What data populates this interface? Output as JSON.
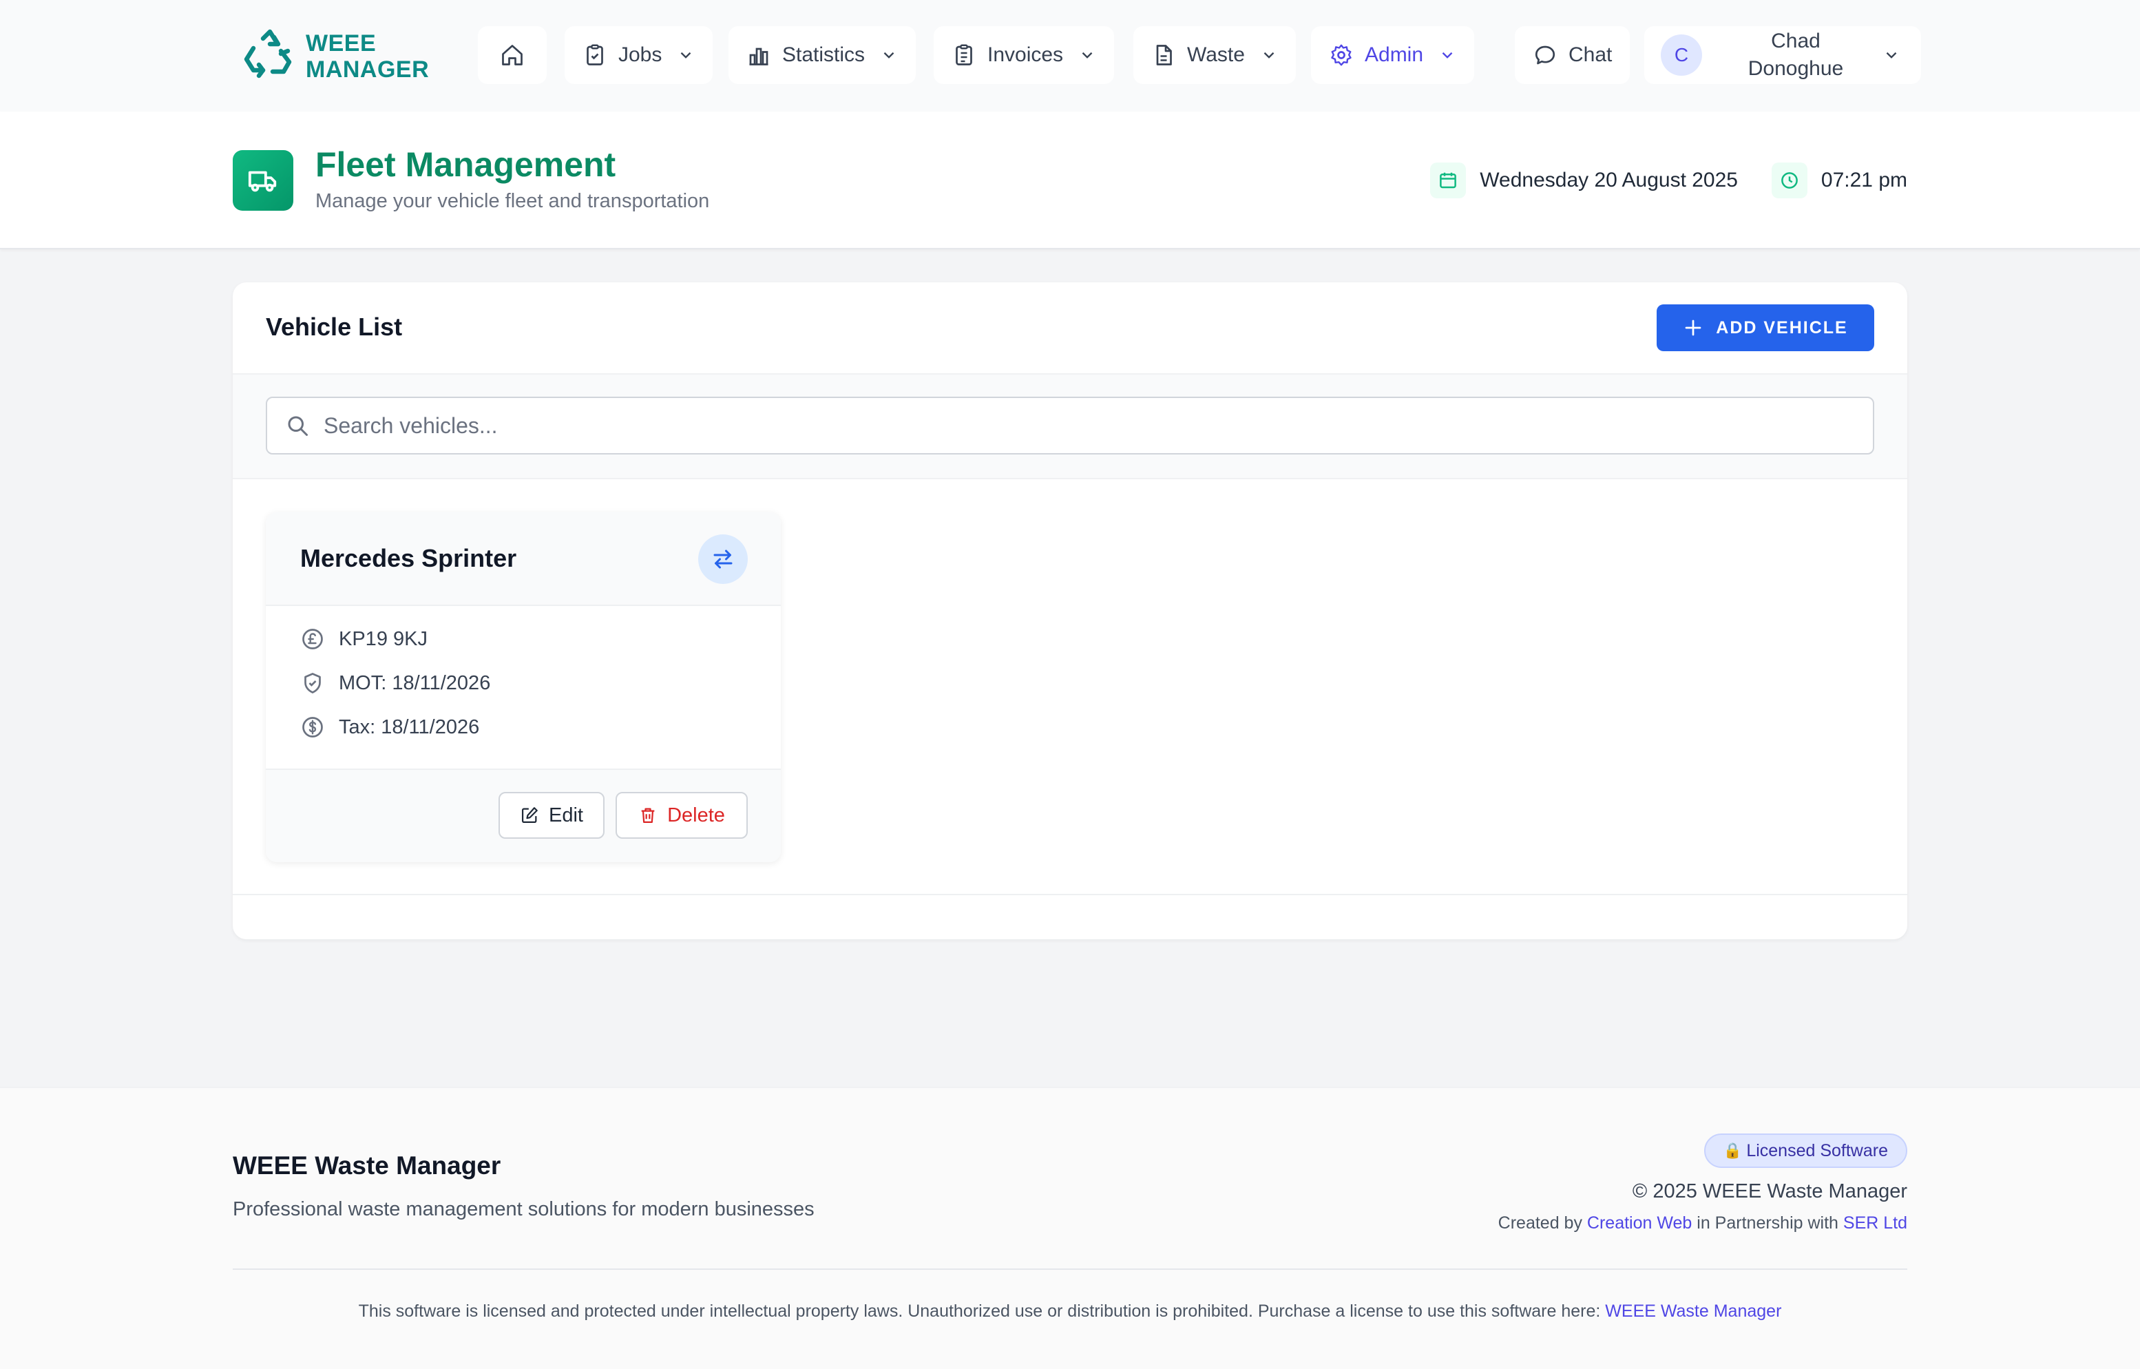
{
  "app": {
    "logo_line1": "WEEE",
    "logo_line2": "MANAGER",
    "brand_color": "#0d8a86"
  },
  "nav": {
    "items": [
      {
        "id": "home",
        "label": "",
        "icon": "home-icon",
        "dropdown": false
      },
      {
        "id": "jobs",
        "label": "Jobs",
        "icon": "clipboard-check-icon",
        "dropdown": true
      },
      {
        "id": "statistics",
        "label": "Statistics",
        "icon": "bar-chart-icon",
        "dropdown": true
      },
      {
        "id": "invoices",
        "label": "Invoices",
        "icon": "clipboard-list-icon",
        "dropdown": true
      },
      {
        "id": "waste",
        "label": "Waste",
        "icon": "document-icon",
        "dropdown": true
      },
      {
        "id": "admin",
        "label": "Admin",
        "icon": "gear-icon",
        "dropdown": true,
        "active": true
      },
      {
        "id": "chat",
        "label": "Chat",
        "icon": "chat-icon",
        "dropdown": false
      }
    ],
    "user": {
      "initial": "C",
      "first_name": "Chad",
      "last_name": "Donoghue"
    },
    "active_color": "#4f46e5"
  },
  "page_header": {
    "title": "Fleet Management",
    "subtitle": "Manage your vehicle fleet and transportation",
    "date": "Wednesday 20 August 2025",
    "time": "07:21 pm",
    "accent_color": "#10b981"
  },
  "vehicle_list": {
    "title": "Vehicle List",
    "add_button_label": "ADD VEHICLE",
    "search_placeholder": "Search vehicles...",
    "vehicles": [
      {
        "name": "Mercedes Sprinter",
        "registration": "KP19 9KJ",
        "mot": "MOT: 18/11/2026",
        "tax": "Tax: 18/11/2026",
        "edit_label": "Edit",
        "delete_label": "Delete"
      }
    ]
  },
  "footer": {
    "brand": "WEEE Waste Manager",
    "tagline": "Professional waste management solutions for modern businesses",
    "license_badge": "Licensed Software",
    "copyright": "© 2025 WEEE Waste Manager",
    "created_prefix": "Created by",
    "created_link": "Creation Web",
    "partnership_text": "in Partnership with",
    "partner_link": "SER Ltd",
    "legal_text": "This software is licensed and protected under intellectual property laws. Unauthorized use or distribution is prohibited. Purchase a license to use this software here:",
    "legal_link": "WEEE Waste Manager"
  }
}
